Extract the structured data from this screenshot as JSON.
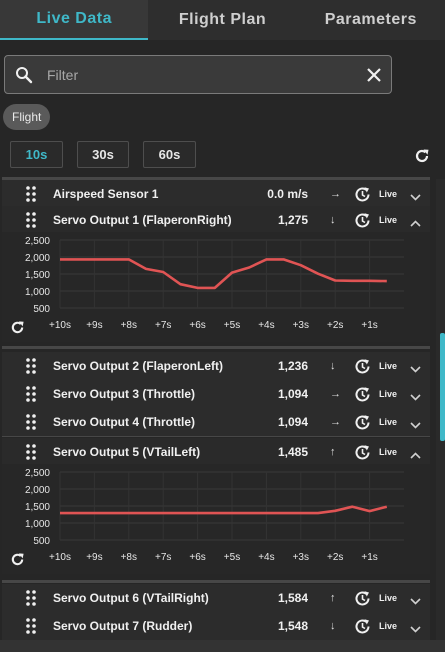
{
  "tabs": [
    {
      "label": "Live Data",
      "active": true
    },
    {
      "label": "Flight Plan",
      "active": false
    },
    {
      "label": "Parameters",
      "active": false
    }
  ],
  "filter": {
    "placeholder": "Filter",
    "value": ""
  },
  "chips": [
    {
      "label": "Flight"
    }
  ],
  "time_ranges": [
    {
      "label": "10s",
      "active": true
    },
    {
      "label": "30s",
      "active": false
    },
    {
      "label": "60s",
      "active": false
    }
  ],
  "live_label": "Live",
  "colors": {
    "accent": "#3fb8c8",
    "series": "#e05454"
  },
  "icons": {
    "search": "search-icon",
    "clear": "close-icon",
    "refresh": "refresh-icon",
    "drag": "drag-handle-icon",
    "history": "history-icon",
    "expand": "chevron-down-icon",
    "collapse": "chevron-up-icon"
  },
  "rows": [
    {
      "name": "Airspeed Sensor 1",
      "value": "0.0 m/s",
      "trend": "→",
      "expanded": false
    },
    {
      "name": "Servo Output 1 (FlaperonRight)",
      "value": "1,275",
      "trend": "↓",
      "expanded": true
    },
    {
      "name": "Servo Output 2 (FlaperonLeft)",
      "value": "1,236",
      "trend": "↓",
      "expanded": false
    },
    {
      "name": "Servo Output 3 (Throttle)",
      "value": "1,094",
      "trend": "→",
      "expanded": false
    },
    {
      "name": "Servo Output 4 (Throttle)",
      "value": "1,094",
      "trend": "→",
      "expanded": false
    },
    {
      "name": "Servo Output 5 (VTailLeft)",
      "value": "1,485",
      "trend": "↑",
      "expanded": true
    },
    {
      "name": "Servo Output 6 (VTailRight)",
      "value": "1,584",
      "trend": "↑",
      "expanded": false
    },
    {
      "name": "Servo Output 7 (Rudder)",
      "value": "1,548",
      "trend": "↓",
      "expanded": false
    }
  ],
  "chart_data": [
    {
      "type": "line",
      "series_row": "Servo Output 1 (FlaperonRight)",
      "x_tick_labels": [
        "+10s",
        "+9s",
        "+8s",
        "+7s",
        "+6s",
        "+5s",
        "+4s",
        "+3s",
        "+2s",
        "+1s"
      ],
      "y_tick_labels": [
        "2,500",
        "2,000",
        "1,500",
        "1,000",
        "500"
      ],
      "y_ticks": [
        2500,
        2000,
        1500,
        1000,
        500
      ],
      "ylim": [
        500,
        2500
      ],
      "xlim": [
        10,
        0
      ],
      "x": [
        10,
        9.5,
        9,
        8.5,
        8,
        7.5,
        7,
        6.5,
        6,
        5.5,
        5,
        4.5,
        4,
        3.5,
        3,
        2.5,
        2,
        1.5,
        1,
        0.5
      ],
      "y": [
        1930,
        1930,
        1930,
        1930,
        1930,
        1650,
        1560,
        1200,
        1090,
        1090,
        1540,
        1690,
        1930,
        1930,
        1760,
        1510,
        1310,
        1300,
        1300,
        1290
      ]
    },
    {
      "type": "line",
      "series_row": "Servo Output 5 (VTailLeft)",
      "x_tick_labels": [
        "+10s",
        "+9s",
        "+8s",
        "+7s",
        "+6s",
        "+5s",
        "+4s",
        "+3s",
        "+2s",
        "+1s"
      ],
      "y_tick_labels": [
        "2,500",
        "2,000",
        "1,500",
        "1,000",
        "500"
      ],
      "y_ticks": [
        2500,
        2000,
        1500,
        1000,
        500
      ],
      "ylim": [
        500,
        2500
      ],
      "xlim": [
        10,
        0
      ],
      "x": [
        10,
        9,
        8,
        7,
        6,
        5,
        4,
        3,
        2.5,
        2,
        1.5,
        1,
        0.5
      ],
      "y": [
        1290,
        1290,
        1290,
        1290,
        1290,
        1290,
        1290,
        1290,
        1290,
        1360,
        1480,
        1350,
        1480
      ]
    }
  ]
}
